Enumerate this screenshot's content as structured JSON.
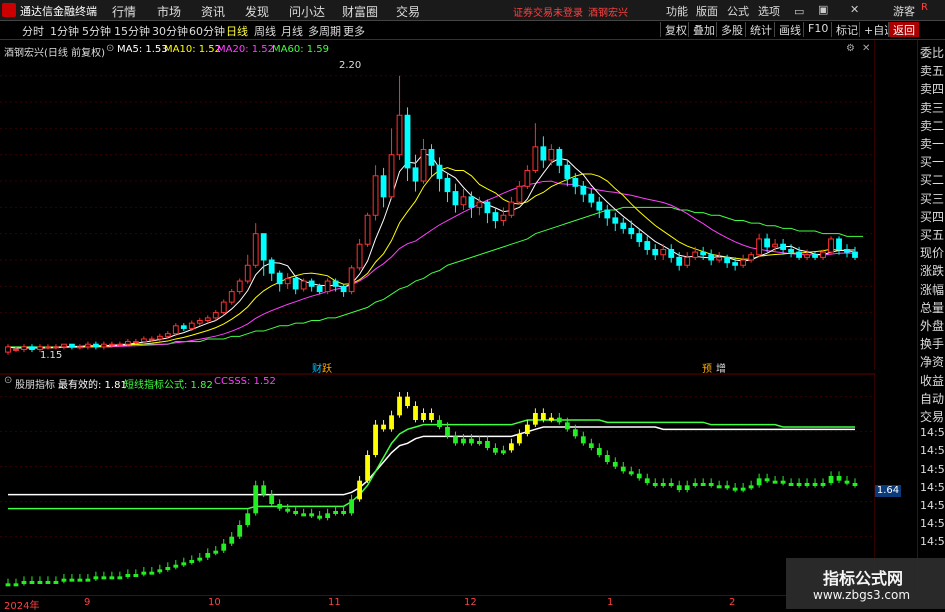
{
  "app": {
    "title": "通达信金融终端"
  },
  "menubar": {
    "items": [
      "行情",
      "市场",
      "资讯",
      "发现",
      "问小达",
      "财富圈",
      "交易"
    ],
    "login_status": "证券交易未登录",
    "stock": "酒钢宏兴",
    "right_items": [
      "功能",
      "版面",
      "公式",
      "选项"
    ],
    "guest": "游客",
    "r_button": "R"
  },
  "toolbar": {
    "periods": [
      "分时",
      "1分钟",
      "5分钟",
      "15分钟",
      "30分钟",
      "60分钟",
      "日线",
      "周线",
      "月线",
      "多周期",
      "更多"
    ],
    "active_period": "日线",
    "right_buttons": [
      "复权",
      "叠加",
      "多股",
      "统计",
      "画线",
      "F10",
      "标记",
      "+自选",
      "返回"
    ],
    "active_button": "返回",
    "icons": [
      "settings-icon",
      "close-icon"
    ]
  },
  "main_legend": {
    "title": "酒钢宏兴(日线 前复权)",
    "ma5": "MA5: 1.53",
    "ma10": "MA10: 1.52",
    "ma20": "MA20: 1.52",
    "ma60": "MA60: 1.59",
    "colors": {
      "ma5": "#ffffff",
      "ma10": "#ffff00",
      "ma20": "#ff40ff",
      "ma60": "#40ff40"
    }
  },
  "main_axis": {
    "ticks": [
      "2.20",
      "2.10",
      "2.00",
      "1.90",
      "1.80",
      "1.70",
      "1.60",
      "1.50",
      "1.40",
      "1.30",
      "1.20"
    ]
  },
  "main_annotations": {
    "high": "2.20",
    "low": "1.15",
    "event1": "财",
    "event1b": "跃",
    "event2": "预",
    "event2b": "增"
  },
  "sub_legend": {
    "name": "股朋指标",
    "most_effective": "最有效的: 1.81",
    "formula": "短线指标公式: 1.82",
    "ccsss": "CCSSS: 1.52",
    "colors": {
      "most_effective": "#ffffff",
      "formula": "#40ff40",
      "ccsss": "#ff40ff"
    }
  },
  "sub_axis": {
    "ticks": [
      "2.20",
      "2.00",
      "1.80",
      "1.60",
      "1.40"
    ]
  },
  "sub_badge": "1.64",
  "right_panel": {
    "items": [
      "委比",
      "卖五",
      "卖四",
      "卖三",
      "卖二",
      "卖一",
      "买一",
      "买二",
      "买三",
      "买四",
      "买五",
      "现价",
      "涨跌",
      "涨幅",
      "总量",
      "外盘",
      "换手",
      "净资",
      "收益",
      "自动",
      "交易",
      "14:56",
      "14:56",
      "14:56",
      "14:56",
      "14:56",
      "14:56",
      "14:56"
    ]
  },
  "date_axis": {
    "labels": [
      "2024年",
      "9",
      "10",
      "11",
      "12",
      "1",
      "2"
    ]
  },
  "watermark": {
    "line1": "指标公式网",
    "line2": "www.zbgs3.com"
  },
  "chart_data": {
    "type": "candlestick",
    "price_range": [
      1.15,
      2.25
    ],
    "candles": [
      [
        1.15,
        1.17,
        1.14,
        1.18
      ],
      [
        1.16,
        1.16,
        1.15,
        1.17
      ],
      [
        1.16,
        1.17,
        1.15,
        1.18
      ],
      [
        1.17,
        1.16,
        1.15,
        1.18
      ],
      [
        1.16,
        1.17,
        1.15,
        1.18
      ],
      [
        1.17,
        1.17,
        1.16,
        1.18
      ],
      [
        1.17,
        1.17,
        1.16,
        1.18
      ],
      [
        1.17,
        1.18,
        1.16,
        1.18
      ],
      [
        1.18,
        1.17,
        1.16,
        1.18
      ],
      [
        1.17,
        1.17,
        1.16,
        1.18
      ],
      [
        1.17,
        1.18,
        1.16,
        1.19
      ],
      [
        1.18,
        1.17,
        1.16,
        1.19
      ],
      [
        1.17,
        1.18,
        1.16,
        1.19
      ],
      [
        1.18,
        1.18,
        1.17,
        1.19
      ],
      [
        1.18,
        1.18,
        1.17,
        1.19
      ],
      [
        1.18,
        1.19,
        1.17,
        1.2
      ],
      [
        1.19,
        1.19,
        1.18,
        1.2
      ],
      [
        1.19,
        1.2,
        1.18,
        1.21
      ],
      [
        1.2,
        1.2,
        1.19,
        1.21
      ],
      [
        1.2,
        1.21,
        1.19,
        1.22
      ],
      [
        1.21,
        1.22,
        1.2,
        1.23
      ],
      [
        1.22,
        1.25,
        1.21,
        1.26
      ],
      [
        1.25,
        1.24,
        1.23,
        1.26
      ],
      [
        1.24,
        1.26,
        1.23,
        1.27
      ],
      [
        1.26,
        1.27,
        1.25,
        1.28
      ],
      [
        1.27,
        1.28,
        1.26,
        1.29
      ],
      [
        1.28,
        1.3,
        1.27,
        1.31
      ],
      [
        1.3,
        1.34,
        1.29,
        1.35
      ],
      [
        1.34,
        1.38,
        1.33,
        1.39
      ],
      [
        1.38,
        1.42,
        1.37,
        1.43
      ],
      [
        1.42,
        1.48,
        1.41,
        1.52
      ],
      [
        1.48,
        1.6,
        1.47,
        1.64
      ],
      [
        1.6,
        1.5,
        1.44,
        1.6
      ],
      [
        1.5,
        1.45,
        1.42,
        1.51
      ],
      [
        1.45,
        1.41,
        1.38,
        1.46
      ],
      [
        1.41,
        1.43,
        1.39,
        1.45
      ],
      [
        1.43,
        1.39,
        1.37,
        1.44
      ],
      [
        1.39,
        1.42,
        1.38,
        1.43
      ],
      [
        1.42,
        1.4,
        1.38,
        1.43
      ],
      [
        1.4,
        1.38,
        1.37,
        1.41
      ],
      [
        1.38,
        1.42,
        1.37,
        1.43
      ],
      [
        1.42,
        1.4,
        1.38,
        1.43
      ],
      [
        1.4,
        1.38,
        1.36,
        1.41
      ],
      [
        1.38,
        1.47,
        1.37,
        1.48
      ],
      [
        1.47,
        1.56,
        1.46,
        1.58
      ],
      [
        1.56,
        1.67,
        1.55,
        1.68
      ],
      [
        1.67,
        1.82,
        1.65,
        1.86
      ],
      [
        1.82,
        1.74,
        1.7,
        1.85
      ],
      [
        1.74,
        1.9,
        1.73,
        2.0
      ],
      [
        1.9,
        2.05,
        1.88,
        2.2
      ],
      [
        2.05,
        1.85,
        1.8,
        2.08
      ],
      [
        1.85,
        1.8,
        1.76,
        1.9
      ],
      [
        1.8,
        1.92,
        1.79,
        1.96
      ],
      [
        1.92,
        1.86,
        1.82,
        1.94
      ],
      [
        1.86,
        1.81,
        1.76,
        1.89
      ],
      [
        1.81,
        1.76,
        1.72,
        1.83
      ],
      [
        1.76,
        1.71,
        1.68,
        1.79
      ],
      [
        1.71,
        1.74,
        1.69,
        1.77
      ],
      [
        1.74,
        1.7,
        1.66,
        1.76
      ],
      [
        1.7,
        1.72,
        1.67,
        1.74
      ],
      [
        1.72,
        1.68,
        1.64,
        1.73
      ],
      [
        1.68,
        1.65,
        1.62,
        1.7
      ],
      [
        1.65,
        1.67,
        1.63,
        1.7
      ],
      [
        1.67,
        1.72,
        1.66,
        1.74
      ],
      [
        1.72,
        1.78,
        1.71,
        1.8
      ],
      [
        1.78,
        1.84,
        1.77,
        1.86
      ],
      [
        1.84,
        1.93,
        1.83,
        2.02
      ],
      [
        1.93,
        1.88,
        1.85,
        1.97
      ],
      [
        1.88,
        1.92,
        1.86,
        1.94
      ],
      [
        1.92,
        1.86,
        1.83,
        1.93
      ],
      [
        1.86,
        1.81,
        1.78,
        1.88
      ],
      [
        1.81,
        1.78,
        1.75,
        1.83
      ],
      [
        1.78,
        1.75,
        1.72,
        1.8
      ],
      [
        1.75,
        1.72,
        1.7,
        1.77
      ],
      [
        1.72,
        1.69,
        1.66,
        1.74
      ],
      [
        1.69,
        1.66,
        1.63,
        1.71
      ],
      [
        1.66,
        1.64,
        1.61,
        1.68
      ],
      [
        1.64,
        1.62,
        1.6,
        1.66
      ],
      [
        1.62,
        1.6,
        1.58,
        1.65
      ],
      [
        1.6,
        1.57,
        1.55,
        1.62
      ],
      [
        1.57,
        1.54,
        1.52,
        1.59
      ],
      [
        1.54,
        1.52,
        1.5,
        1.56
      ],
      [
        1.52,
        1.54,
        1.5,
        1.56
      ],
      [
        1.54,
        1.51,
        1.49,
        1.56
      ],
      [
        1.51,
        1.48,
        1.46,
        1.53
      ],
      [
        1.48,
        1.51,
        1.47,
        1.53
      ],
      [
        1.51,
        1.53,
        1.5,
        1.55
      ],
      [
        1.53,
        1.52,
        1.5,
        1.55
      ],
      [
        1.52,
        1.5,
        1.48,
        1.54
      ],
      [
        1.5,
        1.51,
        1.49,
        1.53
      ],
      [
        1.51,
        1.49,
        1.47,
        1.52
      ],
      [
        1.49,
        1.48,
        1.46,
        1.51
      ],
      [
        1.48,
        1.5,
        1.47,
        1.52
      ],
      [
        1.5,
        1.52,
        1.49,
        1.53
      ],
      [
        1.52,
        1.58,
        1.51,
        1.6
      ],
      [
        1.58,
        1.55,
        1.53,
        1.6
      ],
      [
        1.55,
        1.56,
        1.53,
        1.58
      ],
      [
        1.56,
        1.54,
        1.52,
        1.58
      ],
      [
        1.54,
        1.53,
        1.51,
        1.56
      ],
      [
        1.53,
        1.51,
        1.5,
        1.55
      ],
      [
        1.51,
        1.52,
        1.5,
        1.54
      ],
      [
        1.52,
        1.51,
        1.5,
        1.53
      ],
      [
        1.51,
        1.53,
        1.5,
        1.54
      ],
      [
        1.53,
        1.58,
        1.52,
        1.59
      ],
      [
        1.58,
        1.54,
        1.52,
        1.59
      ],
      [
        1.54,
        1.53,
        1.51,
        1.56
      ],
      [
        1.53,
        1.51,
        1.5,
        1.55
      ]
    ],
    "ma60": [
      1.17,
      1.17,
      1.17,
      1.17,
      1.17,
      1.17,
      1.17,
      1.17,
      1.17,
      1.17,
      1.17,
      1.17,
      1.17,
      1.17,
      1.18,
      1.18,
      1.18,
      1.18,
      1.18,
      1.18,
      1.18,
      1.19,
      1.19,
      1.19,
      1.19,
      1.2,
      1.2,
      1.2,
      1.21,
      1.21,
      1.22,
      1.23,
      1.23,
      1.24,
      1.25,
      1.25,
      1.26,
      1.26,
      1.27,
      1.27,
      1.28,
      1.28,
      1.29,
      1.3,
      1.31,
      1.32,
      1.34,
      1.35,
      1.37,
      1.39,
      1.4,
      1.42,
      1.43,
      1.45,
      1.46,
      1.48,
      1.49,
      1.5,
      1.51,
      1.52,
      1.53,
      1.54,
      1.55,
      1.56,
      1.57,
      1.58,
      1.6,
      1.61,
      1.62,
      1.63,
      1.64,
      1.65,
      1.66,
      1.67,
      1.68,
      1.69,
      1.69,
      1.7,
      1.7,
      1.7,
      1.7,
      1.7,
      1.7,
      1.7,
      1.69,
      1.69,
      1.68,
      1.68,
      1.67,
      1.67,
      1.66,
      1.65,
      1.65,
      1.64,
      1.64,
      1.63,
      1.63,
      1.62,
      1.62,
      1.61,
      1.61,
      1.61,
      1.6,
      1.6,
      1.6,
      1.59,
      1.59,
      1.59
    ],
    "sub_values": [
      0.3,
      0.3,
      0.31,
      0.31,
      0.31,
      0.31,
      0.31,
      0.32,
      0.32,
      0.32,
      0.32,
      0.33,
      0.33,
      0.33,
      0.33,
      0.34,
      0.34,
      0.35,
      0.35,
      0.36,
      0.37,
      0.38,
      0.39,
      0.4,
      0.41,
      0.43,
      0.44,
      0.47,
      0.5,
      0.55,
      0.6,
      0.72,
      0.68,
      0.64,
      0.62,
      0.61,
      0.6,
      0.6,
      0.59,
      0.58,
      0.6,
      0.61,
      0.6,
      0.66,
      0.74,
      0.85,
      0.98,
      0.96,
      1.02,
      1.1,
      1.06,
      1.0,
      1.03,
      1.0,
      0.97,
      0.93,
      0.9,
      0.92,
      0.9,
      0.91,
      0.88,
      0.86,
      0.87,
      0.9,
      0.94,
      0.98,
      1.03,
      1.0,
      1.01,
      0.99,
      0.96,
      0.93,
      0.9,
      0.88,
      0.85,
      0.82,
      0.8,
      0.78,
      0.77,
      0.75,
      0.73,
      0.72,
      0.73,
      0.72,
      0.7,
      0.72,
      0.73,
      0.73,
      0.72,
      0.72,
      0.71,
      0.7,
      0.71,
      0.72,
      0.75,
      0.74,
      0.74,
      0.73,
      0.73,
      0.72,
      0.73,
      0.72,
      0.73,
      0.76,
      0.74,
      0.73,
      0.72
    ],
    "sub_line_white": [
      0.68,
      0.68,
      0.68,
      0.68,
      0.68,
      0.68,
      0.68,
      0.68,
      0.68,
      0.68,
      0.68,
      0.68,
      0.68,
      0.68,
      0.68,
      0.68,
      0.68,
      0.68,
      0.68,
      0.68,
      0.68,
      0.68,
      0.68,
      0.68,
      0.68,
      0.68,
      0.68,
      0.68,
      0.68,
      0.68,
      0.68,
      0.68,
      0.68,
      0.68,
      0.68,
      0.68,
      0.68,
      0.68,
      0.68,
      0.68,
      0.68,
      0.68,
      0.68,
      0.69,
      0.71,
      0.74,
      0.78,
      0.82,
      0.86,
      0.89,
      0.9,
      0.92,
      0.93,
      0.93,
      0.93,
      0.93,
      0.93,
      0.93,
      0.93,
      0.93,
      0.93,
      0.93,
      0.93,
      0.93,
      0.94,
      0.95,
      0.96,
      0.97,
      0.97,
      0.97,
      0.97,
      0.97,
      0.97,
      0.97,
      0.97,
      0.97,
      0.97,
      0.97,
      0.97,
      0.97,
      0.97,
      0.97,
      0.96,
      0.96,
      0.96,
      0.96,
      0.96,
      0.96,
      0.96,
      0.96,
      0.96,
      0.96,
      0.96,
      0.96,
      0.96,
      0.96,
      0.96,
      0.96,
      0.96,
      0.96,
      0.96,
      0.96,
      0.96,
      0.96,
      0.96,
      0.96,
      0.96
    ],
    "sub_line_green": [
      0.62,
      0.62,
      0.62,
      0.62,
      0.62,
      0.62,
      0.62,
      0.62,
      0.62,
      0.62,
      0.62,
      0.62,
      0.62,
      0.62,
      0.62,
      0.62,
      0.62,
      0.62,
      0.62,
      0.62,
      0.62,
      0.62,
      0.62,
      0.62,
      0.62,
      0.62,
      0.62,
      0.62,
      0.62,
      0.62,
      0.62,
      0.63,
      0.63,
      0.63,
      0.63,
      0.63,
      0.63,
      0.63,
      0.63,
      0.63,
      0.63,
      0.63,
      0.63,
      0.65,
      0.68,
      0.72,
      0.78,
      0.84,
      0.9,
      0.94,
      0.96,
      0.97,
      0.98,
      0.98,
      0.98,
      0.98,
      0.98,
      0.98,
      0.98,
      0.98,
      0.98,
      0.98,
      0.98,
      0.98,
      0.99,
      1.0,
      1.0,
      1.0,
      1.0,
      1.0,
      1.0,
      1.0,
      1.0,
      1.0,
      1.0,
      0.99,
      0.99,
      0.99,
      0.99,
      0.99,
      0.99,
      0.99,
      0.99,
      0.99,
      0.99,
      0.99,
      0.99,
      0.99,
      0.98,
      0.98,
      0.98,
      0.98,
      0.98,
      0.98,
      0.98,
      0.98,
      0.98,
      0.97,
      0.97,
      0.97,
      0.97,
      0.97,
      0.97,
      0.97,
      0.97,
      0.97,
      0.97
    ]
  }
}
